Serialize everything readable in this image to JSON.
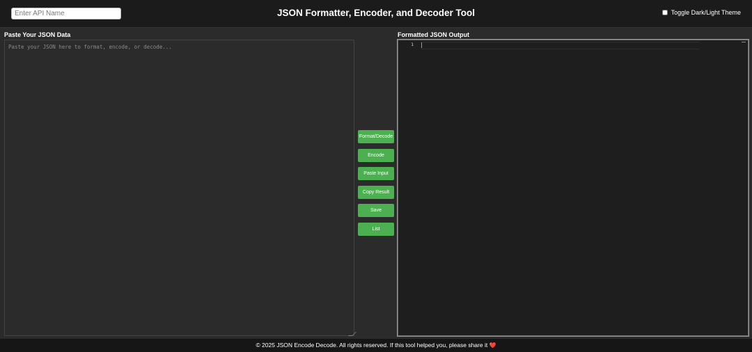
{
  "header": {
    "api_name_placeholder": "Enter API Name",
    "title": "JSON Formatter, Encoder, and Decoder Tool",
    "theme_toggle_label": "Toggle Dark/Light Theme"
  },
  "input_panel": {
    "label": "Paste Your JSON Data",
    "placeholder": "Paste your JSON here to format, encode, or decode..."
  },
  "actions": {
    "format_decode": "Format/Decode",
    "encode": "Encode",
    "paste_input": "Paste Input",
    "copy_result": "Copy Result",
    "save": "Save",
    "list": "List"
  },
  "output_panel": {
    "label": "Formatted JSON Output",
    "line_number": "1"
  },
  "footer": {
    "text": "© 2025 JSON Encode Decode. All rights reserved. If this tool helped you, please share it",
    "heart": "❤️"
  },
  "colors": {
    "accent_button": "#4caf50",
    "background": "#2b2b2b",
    "header_bg": "#1b1b1b",
    "output_bg": "#1e1e1e"
  }
}
